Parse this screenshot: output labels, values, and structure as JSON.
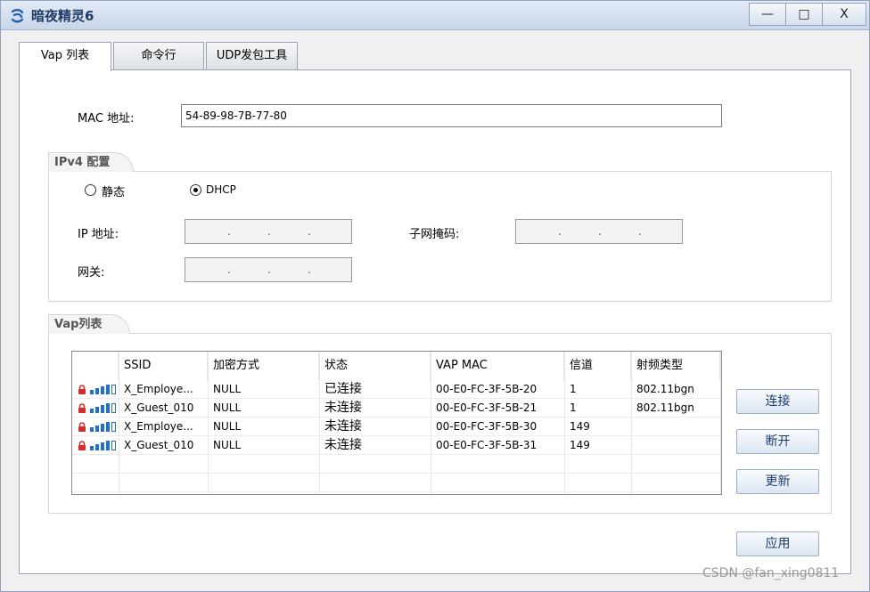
{
  "window": {
    "title": "暗夜精灵6",
    "minimize_label": "—",
    "maximize_label": "□",
    "close_label": "X"
  },
  "tabs": [
    {
      "label": "Vap 列表"
    },
    {
      "label": "命令行"
    },
    {
      "label": "UDP发包工具"
    }
  ],
  "mac": {
    "label": "MAC 地址:",
    "value": "54-89-98-7B-77-80"
  },
  "ipv4": {
    "group_title": "IPv4 配置",
    "static_label": "静态",
    "dhcp_label": "DHCP",
    "selected": "DHCP",
    "ip_label": "IP 地址:",
    "subnet_label": "子网掩码:",
    "gateway_label": "网关:",
    "ip_dots": ".",
    "subnet_dots": ".",
    "gateway_dots": "."
  },
  "vap": {
    "group_title": "Vap列表",
    "columns": [
      "",
      "SSID",
      "加密方式",
      "状态",
      "VAP MAC",
      "信道",
      "射频类型"
    ],
    "rows": [
      {
        "ssid": "X_Employe...",
        "enc": "NULL",
        "status": "已连接",
        "mac": "00-E0-FC-3F-5B-20",
        "channel": "1",
        "radio": "802.11bgn"
      },
      {
        "ssid": "X_Guest_010",
        "enc": "NULL",
        "status": "未连接",
        "mac": "00-E0-FC-3F-5B-21",
        "channel": "1",
        "radio": "802.11bgn"
      },
      {
        "ssid": "X_Employe...",
        "enc": "NULL",
        "status": "未连接",
        "mac": "00-E0-FC-3F-5B-30",
        "channel": "149",
        "radio": ""
      },
      {
        "ssid": "X_Guest_010",
        "enc": "NULL",
        "status": "未连接",
        "mac": "00-E0-FC-3F-5B-31",
        "channel": "149",
        "radio": ""
      }
    ],
    "icons": {
      "lock": "lock-icon",
      "signal": "signal-bars-icon"
    }
  },
  "buttons": {
    "connect": "连接",
    "disconnect": "断开",
    "refresh": "更新",
    "apply": "应用"
  },
  "watermark": "CSDN @fan_xing0811",
  "colors": {
    "title_text": "#1f3b66",
    "button_text": "#1c3c70",
    "lock_red": "#d42b2b",
    "signal_blue": "#1f6fd6"
  }
}
